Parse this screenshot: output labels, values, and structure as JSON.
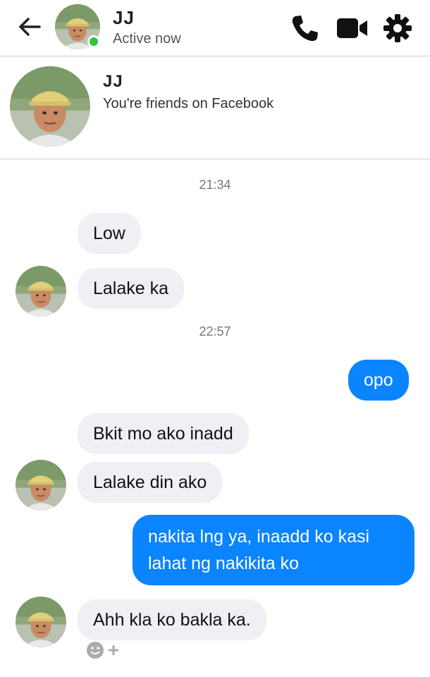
{
  "header": {
    "name": "JJ",
    "status": "Active now"
  },
  "profile": {
    "name": "JJ",
    "subtitle": "You're friends on Facebook"
  },
  "messages": {
    "t1": "21:34",
    "m1": "Low",
    "m2": "Lalake ka",
    "t2": "22:57",
    "m3": "opo",
    "m4": "Bkit mo ako inadd",
    "m5": "Lalake din ako",
    "m6": "nakita lng ya, inaadd ko kasi lahat ng nakikita ko",
    "m7": "Ahh kla ko bakla ka."
  },
  "colors": {
    "outgoing": "#0a84ff",
    "incoming": "#eef0f3",
    "online": "#31c540"
  },
  "icons": [
    "back-arrow-icon",
    "phone-icon",
    "video-camera-icon",
    "gear-icon",
    "emoji-react-icon",
    "plus-icon"
  ]
}
